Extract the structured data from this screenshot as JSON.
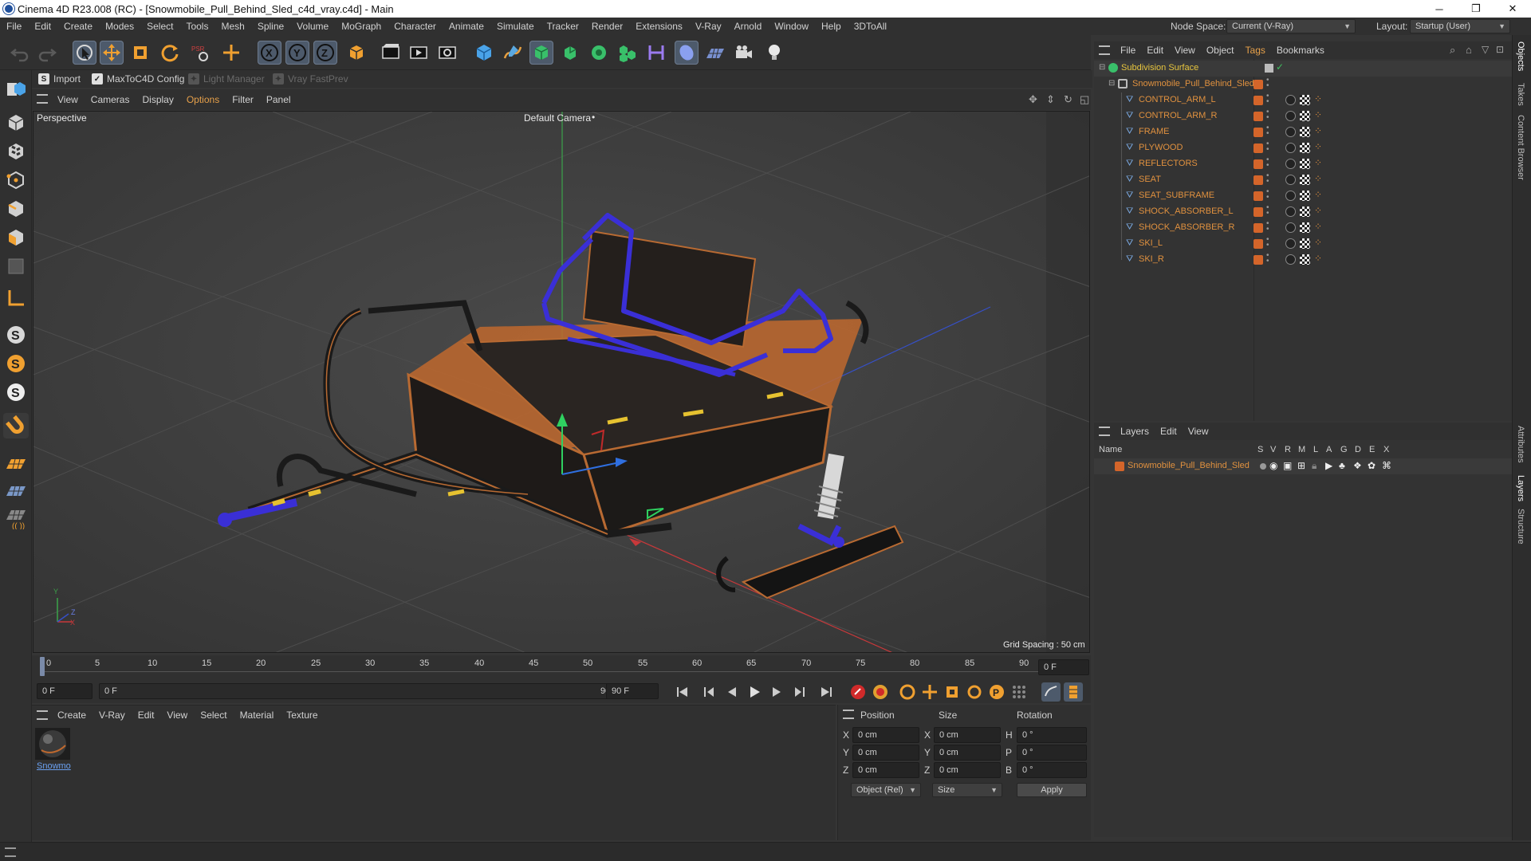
{
  "window": {
    "title": "Cinema 4D R23.008 (RC) - [Snowmobile_Pull_Behind_Sled_c4d_vray.c4d] - Main",
    "minimize": "─",
    "maximize": "❐",
    "close": "✕"
  },
  "menubar": {
    "items": [
      "File",
      "Edit",
      "Create",
      "Modes",
      "Select",
      "Tools",
      "Mesh",
      "Spline",
      "Volume",
      "MoGraph",
      "Character",
      "Animate",
      "Simulate",
      "Tracker",
      "Render",
      "Extensions",
      "V-Ray",
      "Arnold",
      "Window",
      "Help",
      "3DToAll"
    ],
    "node_space_label": "Node Space:",
    "node_space_value": "Current (V-Ray)",
    "layout_label": "Layout:",
    "layout_value": "Startup (User)"
  },
  "plugins": {
    "import": "Import",
    "maxtoc4d": "MaxToC4D Config",
    "light_manager": "Light Manager",
    "vray_fastprev": "Vray FastPrev"
  },
  "viewport": {
    "menu": [
      "View",
      "Cameras",
      "Display",
      "Options",
      "Filter",
      "Panel"
    ],
    "view_name": "Perspective",
    "camera": "Default Camera",
    "camera_suffix": "•",
    "grid_spacing": "Grid Spacing : 50 cm",
    "axis_x": "X",
    "axis_y": "Y",
    "axis_z": "Z"
  },
  "timeline": {
    "ticks": [
      "0",
      "5",
      "10",
      "15",
      "20",
      "25",
      "30",
      "35",
      "40",
      "45",
      "50",
      "55",
      "60",
      "65",
      "70",
      "75",
      "80",
      "85",
      "90"
    ],
    "frame_field": "0 F",
    "current_frame": "0 F",
    "range_start": "0 F",
    "range_end_inner": "0 F",
    "range_end": "90 F",
    "range_end_field": "90 F"
  },
  "materials": {
    "menu": [
      "Create",
      "V-Ray",
      "Edit",
      "View",
      "Select",
      "Material",
      "Texture"
    ],
    "items": [
      {
        "label": "Snowmo"
      }
    ]
  },
  "coords": {
    "headers": {
      "position": "Position",
      "size": "Size",
      "rotation": "Rotation"
    },
    "rows": [
      {
        "axis": "X",
        "pos": "0 cm",
        "size_axis": "X",
        "size": "0 cm",
        "rot_axis": "H",
        "rot": "0 °"
      },
      {
        "axis": "Y",
        "pos": "0 cm",
        "size_axis": "Y",
        "size": "0 cm",
        "rot_axis": "P",
        "rot": "0 °"
      },
      {
        "axis": "Z",
        "pos": "0 cm",
        "size_axis": "Z",
        "size": "0 cm",
        "rot_axis": "B",
        "rot": "0 °"
      }
    ],
    "mode": "Object (Rel)",
    "size_mode": "Size",
    "apply": "Apply"
  },
  "objects": {
    "menu": [
      "File",
      "Edit",
      "View",
      "Object",
      "Tags",
      "Bookmarks"
    ],
    "root": "Subdivision Surface",
    "parent": "Snowmobile_Pull_Behind_Sled",
    "children": [
      "CONTROL_ARM_L",
      "CONTROL_ARM_R",
      "FRAME",
      "PLYWOOD",
      "REFLECTORS",
      "SEAT",
      "SEAT_SUBFRAME",
      "SHOCK_ABSORBER_L",
      "SHOCK_ABSORBER_R",
      "SKI_L",
      "SKI_R"
    ]
  },
  "layers": {
    "menu": [
      "Layers",
      "Edit",
      "View"
    ],
    "columns": [
      "Name",
      "S",
      "V",
      "R",
      "M",
      "L",
      "A",
      "G",
      "D",
      "E",
      "X"
    ],
    "rows": [
      {
        "name": "Snowmobile_Pull_Behind_Sled"
      }
    ]
  },
  "side_tabs": [
    "Objects",
    "Takes",
    "Content Browser",
    "Attributes",
    "Layers",
    "Structure"
  ],
  "colors": {
    "accent_orange": "#e0913f",
    "layer_orange": "#d4652a",
    "selection_blue": "#4d5a6b",
    "frame_blue": "#3a2fd6"
  }
}
